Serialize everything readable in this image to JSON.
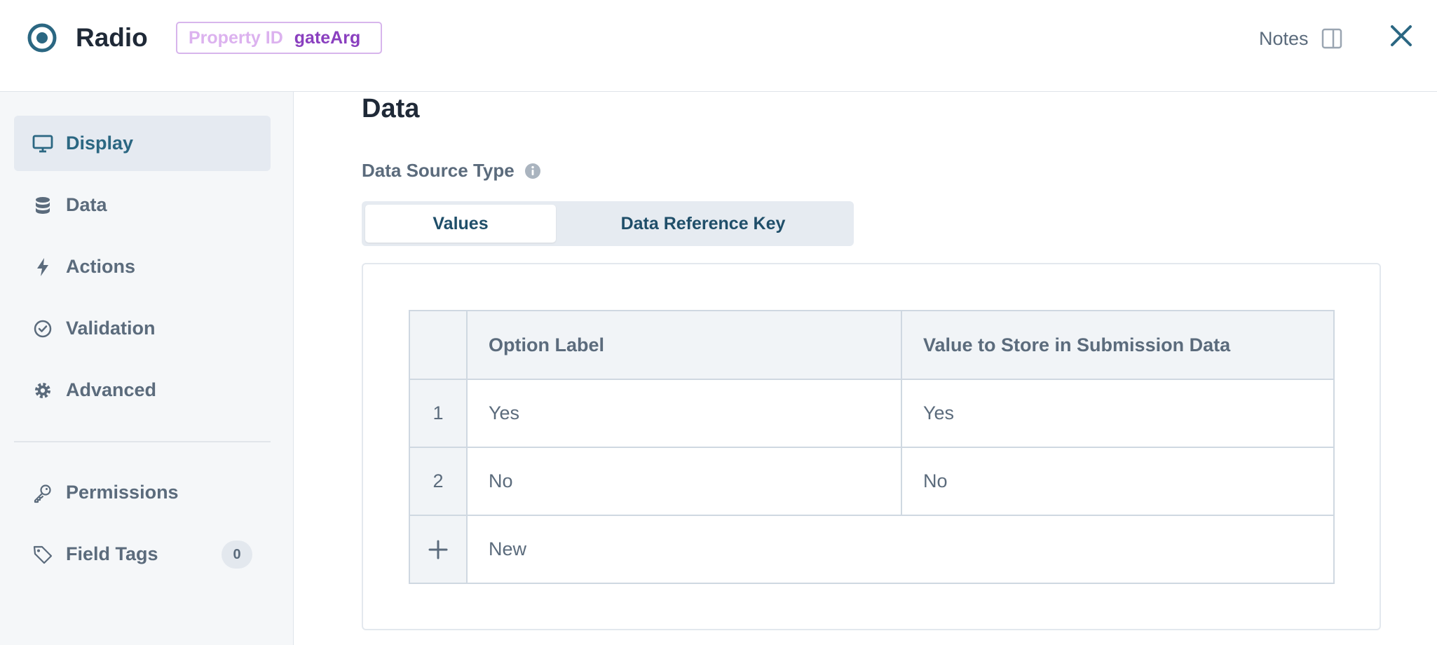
{
  "header": {
    "title": "Radio",
    "property_id_label": "Property ID",
    "property_id_value": "gateArg",
    "notes_label": "Notes"
  },
  "sidebar": {
    "items": [
      {
        "label": "Display",
        "icon": "monitor-icon",
        "active": true
      },
      {
        "label": "Data",
        "icon": "database-icon"
      },
      {
        "label": "Actions",
        "icon": "lightning-icon"
      },
      {
        "label": "Validation",
        "icon": "check-circle-icon"
      },
      {
        "label": "Advanced",
        "icon": "gear-icon"
      },
      {
        "label": "Permissions",
        "icon": "key-icon"
      },
      {
        "label": "Field Tags",
        "icon": "tag-icon",
        "count": "0"
      }
    ]
  },
  "main": {
    "section_title": "Data",
    "data_source_label": "Data Source Type",
    "tabs": [
      {
        "label": "Values",
        "active": true
      },
      {
        "label": "Data Reference Key"
      }
    ],
    "table": {
      "headers": [
        "",
        "Option Label",
        "Value to Store in Submission Data"
      ],
      "rows": [
        {
          "index": "1",
          "label": "Yes",
          "value": "Yes"
        },
        {
          "index": "2",
          "label": "No",
          "value": "No"
        }
      ],
      "new_row_label": "New"
    }
  },
  "colors": {
    "accent": "#2b6782",
    "badge_border": "#d7b5ec",
    "badge_value": "#8a3fbf",
    "sidebar_bg": "#f5f7f9"
  }
}
